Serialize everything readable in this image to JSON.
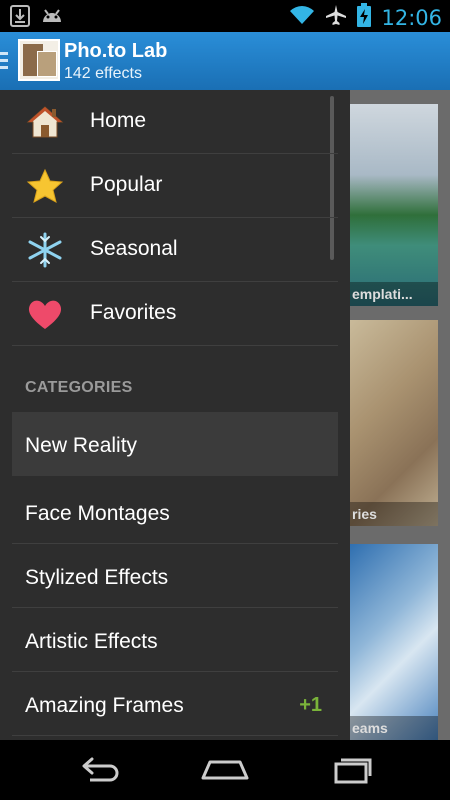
{
  "status_bar": {
    "time": "12:06",
    "icons": [
      "download-icon",
      "android-icon",
      "wifi-icon",
      "airplane-icon",
      "battery-charging-icon"
    ],
    "accent": "#33b5e5"
  },
  "action_bar": {
    "title": "Pho.to Lab",
    "subtitle": "142 effects",
    "background": "#1f7fc6"
  },
  "drawer": {
    "nav_items": [
      {
        "label": "Home",
        "icon": "home-icon"
      },
      {
        "label": "Popular",
        "icon": "star-icon"
      },
      {
        "label": "Seasonal",
        "icon": "snowflake-icon"
      },
      {
        "label": "Favorites",
        "icon": "heart-icon"
      }
    ],
    "categories_header": "CATEGORIES",
    "categories": [
      {
        "label": "New Reality",
        "badge": "",
        "selected": true
      },
      {
        "label": "Face Montages",
        "badge": ""
      },
      {
        "label": "Stylized Effects",
        "badge": ""
      },
      {
        "label": "Artistic Effects",
        "badge": ""
      },
      {
        "label": "Amazing Frames",
        "badge": "+1"
      }
    ],
    "badge_color": "#7ab33a"
  },
  "background_cards": [
    {
      "caption": "emplati..."
    },
    {
      "caption": "ries"
    },
    {
      "caption": "eams"
    }
  ],
  "nav_bar": {
    "buttons": [
      "back-icon",
      "home-icon",
      "recent-apps-icon"
    ]
  }
}
